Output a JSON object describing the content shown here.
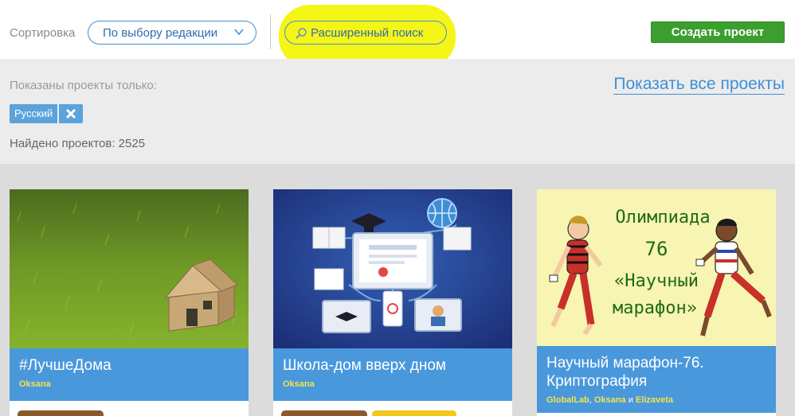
{
  "toolbar": {
    "sort_label": "Сортировка",
    "sort_value": "По выбору редакции",
    "advanced_search": "Расширенный поиск",
    "create_project": "Создать проект",
    "colors": {
      "highlight": "#f5f518",
      "create_button": "#3c9e2f",
      "accent": "#3f8fd6"
    }
  },
  "filter": {
    "shown_label": "Показаны проекты только:",
    "show_all": "Показать все проекты",
    "language_tag": "Русский",
    "found": "Найдено проектов: 2525"
  },
  "cards": [
    {
      "title": "#ЛучшеДома",
      "authors": [
        "Oksana"
      ],
      "image": "grass-house"
    },
    {
      "title": "Школа-дом вверх дном",
      "authors": [
        "Oksana"
      ],
      "image": "online-learning"
    },
    {
      "title": "Научный марафон-76. Криптография",
      "authors": [
        "GlobalLab",
        "Oksana",
        "Elizaveta"
      ],
      "author_separators": [
        ", ",
        " и "
      ],
      "image": "olympiad-runners",
      "image_text": [
        "Олимпиада",
        "76",
        "«Научный",
        "марафон»"
      ]
    }
  ]
}
